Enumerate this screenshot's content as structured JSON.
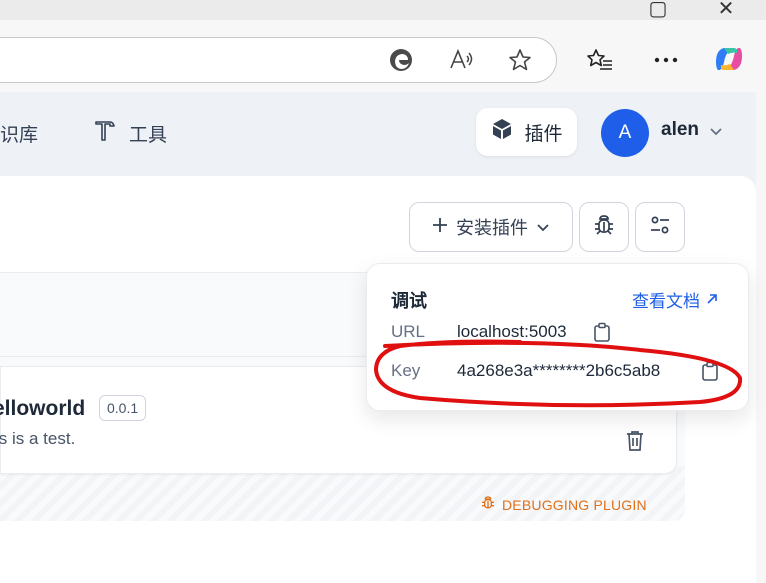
{
  "nav": {
    "knowledge_label": "识库",
    "tools_label": "工具",
    "plugins_label": "插件"
  },
  "user": {
    "avatar_initial": "A",
    "name": "alen"
  },
  "actions": {
    "install_label": "安装插件"
  },
  "plugin": {
    "name": "elloworld",
    "version": "0.0.1",
    "description": "is is a test.",
    "debug_tag": "DEBUGGING PLUGIN"
  },
  "debug_popover": {
    "title": "调试",
    "docs_link": "查看文档",
    "url_label": "URL",
    "url_value": "localhost:5003",
    "key_label": "Key",
    "key_value": "4a268e3a********2b6c5ab8"
  },
  "colors": {
    "accent": "#1e5ee8",
    "debug": "#e0701a",
    "annotation": "#e01010"
  }
}
